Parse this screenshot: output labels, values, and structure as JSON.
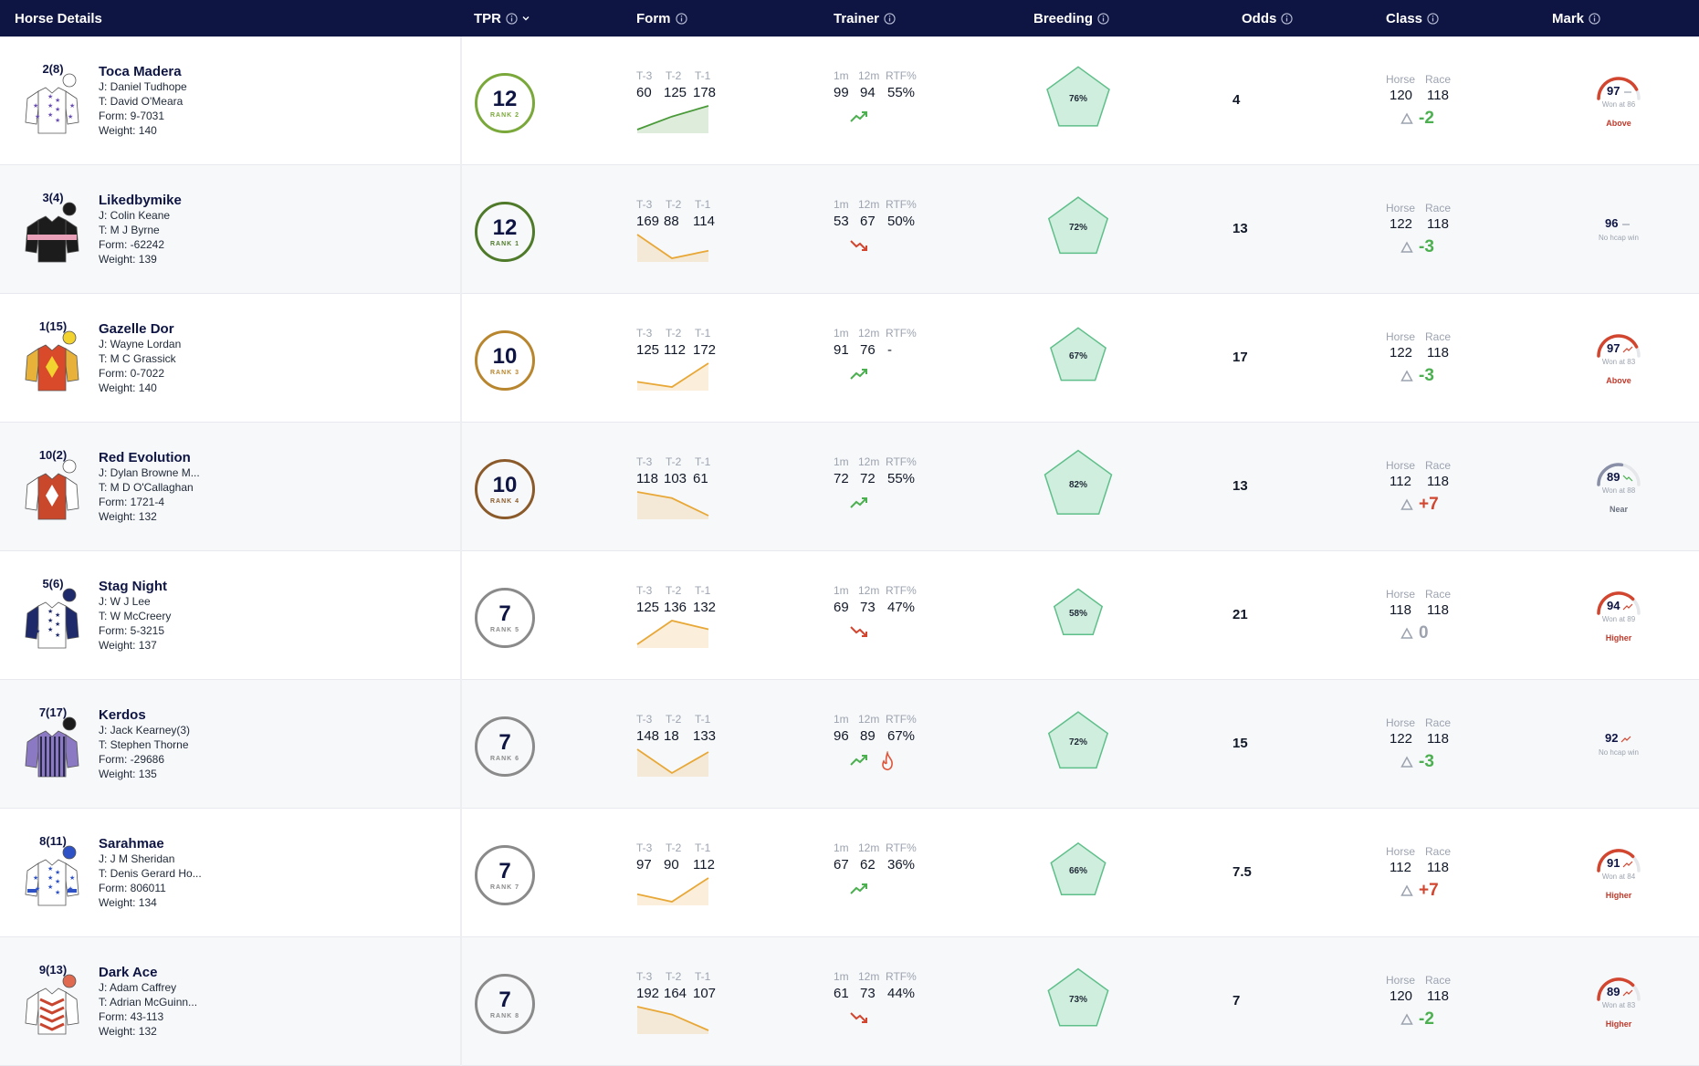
{
  "header": {
    "horse_details": "Horse Details",
    "tpr": "TPR",
    "form": "Form",
    "trainer": "Trainer",
    "breeding": "Breeding",
    "odds": "Odds",
    "class": "Class",
    "mark": "Mark"
  },
  "labels": {
    "t3": "T-3",
    "t2": "T-2",
    "t1": "T-1",
    "m1": "1m",
    "m12": "12m",
    "rtf": "RTF%",
    "horse": "Horse",
    "race": "Race"
  },
  "colors": {
    "header_bg": "#0e1543",
    "navy": "#0e1543",
    "green": "#6aa84f",
    "orange": "#e8a838",
    "red": "#d2452f",
    "pentagon_fill": "#cfeedd",
    "pentagon_stroke": "#5fbf8a"
  },
  "horses": [
    {
      "num": "2(8)",
      "name": "Toca Madera",
      "jockey": "J: Daniel Tudhope",
      "trainer": "T: David O'Meara",
      "form": "Form: 9-7031",
      "weight": "Weight: 140",
      "silk": "white-purple-stars",
      "tpr": "12",
      "rank": "RANK 2",
      "tpr_color": "#7aa83a",
      "form_vals": [
        "60",
        "125",
        "178"
      ],
      "form_trend": "up",
      "spark_color": "#4a9a3a",
      "spark": [
        60,
        125,
        178
      ],
      "tr_1m": "99",
      "tr_12m": "94",
      "tr_rtf": "55%",
      "tr_trend": "up",
      "hot": false,
      "breeding": "76%",
      "breeding_value": 0.76,
      "odds": "4",
      "class_horse": "120",
      "class_race": "118",
      "class_delta": "-2",
      "delta_color": "#4caf50",
      "mark": "97",
      "mark_trend": "flat",
      "mark_gauge": true,
      "gauge_fill": 0.85,
      "gauge_color": "#d2452f",
      "mark_note": "Won at 86",
      "mark_status": "Above",
      "status_color": "#c0392b"
    },
    {
      "num": "3(4)",
      "name": "Likedbymike",
      "jockey": "J: Colin Keane",
      "trainer": "T: M J Byrne",
      "form": "Form: -62242",
      "weight": "Weight: 139",
      "silk": "black-pink-band",
      "tpr": "12",
      "rank": "RANK 1",
      "tpr_color": "#4e7a2a",
      "form_vals": [
        "169",
        "88",
        "114"
      ],
      "form_trend": "vdown",
      "spark_color": "#e8a838",
      "spark": [
        169,
        88,
        114
      ],
      "tr_1m": "53",
      "tr_12m": "67",
      "tr_rtf": "50%",
      "tr_trend": "down",
      "hot": false,
      "breeding": "72%",
      "breeding_value": 0.72,
      "odds": "13",
      "class_horse": "122",
      "class_race": "118",
      "class_delta": "-3",
      "delta_color": "#4caf50",
      "mark": "96",
      "mark_trend": "flat",
      "mark_gauge": false,
      "gauge_fill": 0,
      "gauge_color": "#d2452f",
      "mark_note": "No hcap win",
      "mark_status": "",
      "status_color": "#c0392b"
    },
    {
      "num": "1(15)",
      "name": "Gazelle Dor",
      "jockey": "J: Wayne Lordan",
      "trainer": "T: M C Grassick",
      "form": "Form: 0-7022",
      "weight": "Weight: 140",
      "silk": "red-yellow-diamond",
      "tpr": "10",
      "rank": "RANK 3",
      "tpr_color": "#b8862e",
      "form_vals": [
        "125",
        "112",
        "172"
      ],
      "form_trend": "up",
      "spark_color": "#e8a838",
      "spark": [
        125,
        112,
        172
      ],
      "tr_1m": "91",
      "tr_12m": "76",
      "tr_rtf": "-",
      "tr_trend": "up",
      "hot": false,
      "breeding": "67%",
      "breeding_value": 0.67,
      "odds": "17",
      "class_horse": "122",
      "class_race": "118",
      "class_delta": "-3",
      "delta_color": "#4caf50",
      "mark": "97",
      "mark_trend": "up",
      "mark_gauge": true,
      "gauge_fill": 0.85,
      "gauge_color": "#d2452f",
      "mark_note": "Won at 83",
      "mark_status": "Above",
      "status_color": "#c0392b"
    },
    {
      "num": "10(2)",
      "name": "Red Evolution",
      "jockey": "J: Dylan Browne M...",
      "trainer": "T: M D O'Callaghan",
      "form": "Form: 1721-4",
      "weight": "Weight: 132",
      "silk": "red-white-diamond",
      "tpr": "10",
      "rank": "RANK 4",
      "tpr_color": "#8a5a2a",
      "form_vals": [
        "118",
        "103",
        "61"
      ],
      "form_trend": "down",
      "spark_color": "#e8a838",
      "spark": [
        118,
        103,
        61
      ],
      "tr_1m": "72",
      "tr_12m": "72",
      "tr_rtf": "55%",
      "tr_trend": "up",
      "hot": false,
      "breeding": "82%",
      "breeding_value": 0.82,
      "odds": "13",
      "class_horse": "112",
      "class_race": "118",
      "class_delta": "+7",
      "delta_color": "#d2452f",
      "mark": "89",
      "mark_trend": "down",
      "mark_gauge": true,
      "gauge_fill": 0.55,
      "gauge_color": "#8a8fa8",
      "mark_note": "Won at 88",
      "mark_status": "Near",
      "status_color": "#6b7280"
    },
    {
      "num": "5(6)",
      "name": "Stag Night",
      "jockey": "J: W J Lee",
      "trainer": "T: W McCreery",
      "form": "Form: 5-3215",
      "weight": "Weight: 137",
      "silk": "navy-white-stars",
      "tpr": "7",
      "rank": "RANK 5",
      "tpr_color": "#8a8a8a",
      "form_vals": [
        "125",
        "136",
        "132"
      ],
      "form_trend": "hump",
      "spark_color": "#e8a838",
      "spark": [
        125,
        136,
        132
      ],
      "tr_1m": "69",
      "tr_12m": "73",
      "tr_rtf": "47%",
      "tr_trend": "down",
      "hot": false,
      "breeding": "58%",
      "breeding_value": 0.58,
      "odds": "21",
      "class_horse": "118",
      "class_race": "118",
      "class_delta": "0",
      "delta_color": "#9ca3af",
      "mark": "94",
      "mark_trend": "up",
      "mark_gauge": true,
      "gauge_fill": 0.75,
      "gauge_color": "#d2452f",
      "mark_note": "Won at 89",
      "mark_status": "Higher",
      "status_color": "#c0392b"
    },
    {
      "num": "7(17)",
      "name": "Kerdos",
      "jockey": "J: Jack Kearney(3)",
      "trainer": "T: Stephen Thorne",
      "form": "Form: -29686",
      "weight": "Weight: 135",
      "silk": "purple-stripes",
      "tpr": "7",
      "rank": "RANK 6",
      "tpr_color": "#8a8a8a",
      "form_vals": [
        "148",
        "18",
        "133"
      ],
      "form_trend": "vdown",
      "spark_color": "#e8a838",
      "spark": [
        148,
        18,
        133
      ],
      "tr_1m": "96",
      "tr_12m": "89",
      "tr_rtf": "67%",
      "tr_trend": "up",
      "hot": true,
      "breeding": "72%",
      "breeding_value": 0.72,
      "odds": "15",
      "class_horse": "122",
      "class_race": "118",
      "class_delta": "-3",
      "delta_color": "#4caf50",
      "mark": "92",
      "mark_trend": "up",
      "mark_gauge": false,
      "gauge_fill": 0,
      "gauge_color": "#d2452f",
      "mark_note": "No hcap win",
      "mark_status": "",
      "status_color": "#c0392b"
    },
    {
      "num": "8(11)",
      "name": "Sarahmae",
      "jockey": "J: J M Sheridan",
      "trainer": "T: Denis Gerard Ho...",
      "form": "Form: 806011",
      "weight": "Weight: 134",
      "silk": "white-blue-stars",
      "tpr": "7",
      "rank": "RANK 7",
      "tpr_color": "#8a8a8a",
      "form_vals": [
        "97",
        "90",
        "112"
      ],
      "form_trend": "up",
      "spark_color": "#e8a838",
      "spark": [
        97,
        90,
        112
      ],
      "tr_1m": "67",
      "tr_12m": "62",
      "tr_rtf": "36%",
      "tr_trend": "up",
      "hot": false,
      "breeding": "66%",
      "breeding_value": 0.66,
      "odds": "7.5",
      "class_horse": "112",
      "class_race": "118",
      "class_delta": "+7",
      "delta_color": "#d2452f",
      "mark": "91",
      "mark_trend": "up",
      "mark_gauge": true,
      "gauge_fill": 0.75,
      "gauge_color": "#d2452f",
      "mark_note": "Won at 84",
      "mark_status": "Higher",
      "status_color": "#c0392b"
    },
    {
      "num": "9(13)",
      "name": "Dark Ace",
      "jockey": "J: Adam Caffrey",
      "trainer": "T: Adrian McGuinn...",
      "form": "Form: 43-113",
      "weight": "Weight: 132",
      "silk": "white-red-chevrons",
      "tpr": "7",
      "rank": "RANK 8",
      "tpr_color": "#8a8a8a",
      "form_vals": [
        "192",
        "164",
        "107"
      ],
      "form_trend": "down",
      "spark_color": "#e8a838",
      "spark": [
        192,
        164,
        107
      ],
      "tr_1m": "61",
      "tr_12m": "73",
      "tr_rtf": "44%",
      "tr_trend": "down",
      "hot": false,
      "breeding": "73%",
      "breeding_value": 0.73,
      "odds": "7",
      "class_horse": "120",
      "class_race": "118",
      "class_delta": "-2",
      "delta_color": "#4caf50",
      "mark": "89",
      "mark_trend": "up",
      "mark_gauge": true,
      "gauge_fill": 0.75,
      "gauge_color": "#d2452f",
      "mark_note": "Won at 83",
      "mark_status": "Higher",
      "status_color": "#c0392b"
    }
  ]
}
